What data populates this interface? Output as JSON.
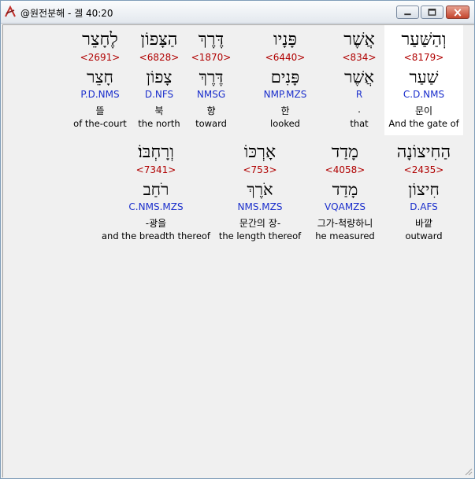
{
  "window": {
    "title": "@원전분해 - 겔 40:20",
    "icon": "app-icon",
    "buttons": {
      "minimize": "minimize-icon",
      "maximize": "maximize-icon",
      "close": "close-icon"
    }
  },
  "colors": {
    "strong": "#b00000",
    "parse": "#1a2ecc",
    "selected_bg": "#ffffff"
  },
  "rows": [
    {
      "words": [
        {
          "heb": "וְהַשַּׁעַר",
          "strong": "<8179>",
          "lemma": "שַׁעַר",
          "parse": "C.D.NMS",
          "korean": "문이",
          "english": "And the gate of",
          "selected": true
        },
        {
          "heb": "אֲשֶׁר",
          "strong": "<834>",
          "lemma": "אֲשֶׁר",
          "parse": "R",
          "korean": ".",
          "english": "that"
        },
        {
          "heb": "פָּנָיו",
          "strong": "<6440>",
          "lemma": "פָּנִים",
          "parse": "NMP.MZS",
          "korean": "한",
          "english": "looked"
        },
        {
          "heb": "דֶּרֶךְ",
          "strong": "<1870>",
          "lemma": "דֶּרֶךְ",
          "parse": "NMSG",
          "korean": "향",
          "english": "toward"
        },
        {
          "heb": "הַצָּפוֹן",
          "strong": "<6828>",
          "lemma": "צָפוֹן",
          "parse": "D.NFS",
          "korean": "북",
          "english": "the north"
        },
        {
          "heb": "לֶחָצֵר",
          "strong": "<2691>",
          "lemma": "חָצֵר",
          "parse": "P.D.NMS",
          "korean": "뜰",
          "english": "of the-court"
        }
      ]
    },
    {
      "words": [
        {
          "heb": "הַחִיצוֹנָה",
          "strong": "<2435>",
          "lemma": "חִיצוֹן",
          "parse": "D.AFS",
          "korean": "바깥",
          "english": "outward"
        },
        {
          "heb": "מָדַד",
          "strong": "<4058>",
          "lemma": "מָדַד",
          "parse": "VQAMZS",
          "korean": "그가-척량하니",
          "english": "he measured"
        },
        {
          "heb": "אָרְכּוֹ",
          "strong": "<753>",
          "lemma": "אֹרֶךְ",
          "parse": "NMS.MZS",
          "korean": "문간의 장-",
          "english": "the length thereof"
        },
        {
          "heb": "וְרָחְבּוֹ׃",
          "strong": "<7341>",
          "lemma": "רֹחַב",
          "parse": "C.NMS.MZS",
          "korean": "-광을",
          "english": "and the breadth thereof"
        }
      ]
    }
  ]
}
